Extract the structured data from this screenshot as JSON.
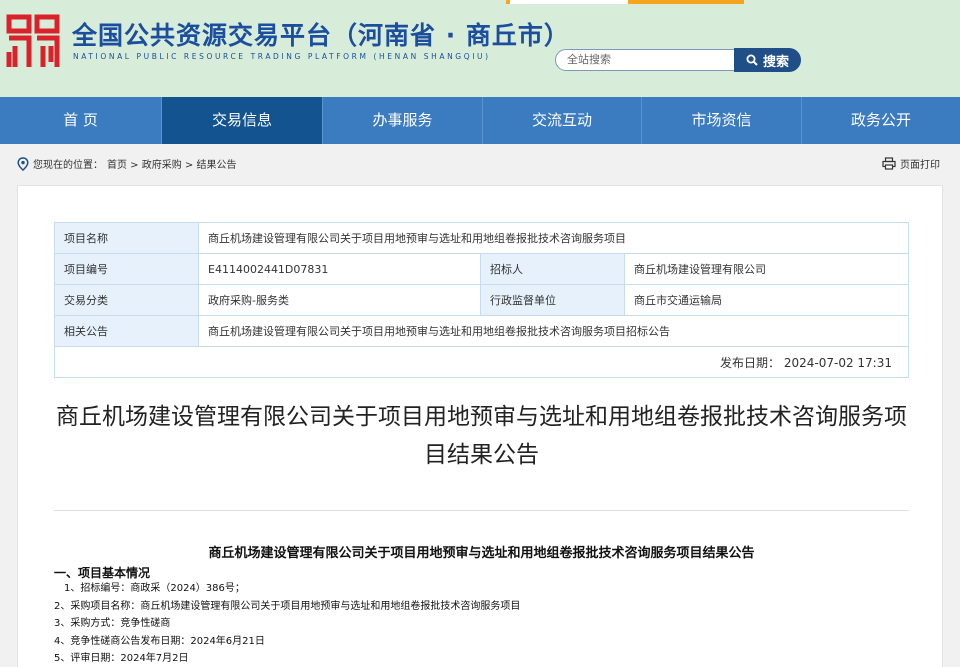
{
  "header": {
    "title": "全国公共资源交易平台（河南省 · 商丘市）",
    "subtitle": "NATIONAL PUBLIC RESOURCE TRADING PLATFORM (HENAN SHANGQIU)",
    "search_placeholder": "全站搜索",
    "search_button": "搜索",
    "brand_color": "#1c4ea0",
    "logo_color": "#d9222a"
  },
  "nav": {
    "items": [
      {
        "label": "首 页"
      },
      {
        "label": "交易信息"
      },
      {
        "label": "办事服务"
      },
      {
        "label": "交流互动"
      },
      {
        "label": "市场资信"
      },
      {
        "label": "政务公开"
      }
    ],
    "active_index": 1
  },
  "breadcrumb": {
    "prefix": "您现在的位置：",
    "path": "首页 > 政府采购 > 结果公告"
  },
  "print_label": "页面打印",
  "info_table": {
    "project_name_label": "项目名称",
    "project_name": "商丘机场建设管理有限公司关于项目用地预审与选址和用地组卷报批技术咨询服务项目",
    "project_no_label": "项目编号",
    "project_no": "E4114002441D07831",
    "tenderer_label": "招标人",
    "tenderer": "商丘机场建设管理有限公司",
    "category_label": "交易分类",
    "category": "政府采购-服务类",
    "supervisor_label": "行政监督单位",
    "supervisor": "商丘市交通运输局",
    "related_label": "相关公告",
    "related": "商丘机场建设管理有限公司关于项目用地预审与选址和用地组卷报批技术咨询服务项目招标公告",
    "publish_label": "发布日期：",
    "publish_date": "2024-07-02 17:31"
  },
  "document": {
    "title": "商丘机场建设管理有限公司关于项目用地预审与选址和用地组卷报批技术咨询服务项目结果公告",
    "body_title": "商丘机场建设管理有限公司关于项目用地预审与选址和用地组卷报批技术咨询服务项目结果公告",
    "section1": "一、项目基本情况",
    "lines": [
      "1、招标编号：商政采（2024）386号；",
      "2、采购项目名称：商丘机场建设管理有限公司关于项目用地预审与选址和用地组卷报批技术咨询服务项目",
      "3、采购方式：竞争性磋商",
      "4、竞争性磋商公告发布日期：2024年6月21日",
      "5、评审日期：2024年7月2日"
    ]
  }
}
